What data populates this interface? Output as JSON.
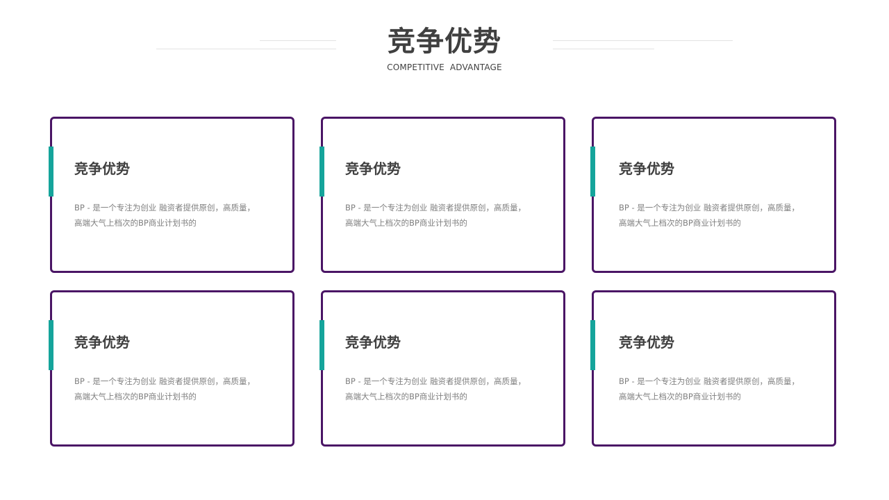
{
  "header": {
    "title": "竞争优势",
    "subtitle": "COMPETITIVE  ADVANTAGE"
  },
  "colors": {
    "title_text": "#404040",
    "body_text": "#7f7f7f",
    "card_border": "#4a1565",
    "card_accent": "#15a49b",
    "decor_line": "#e3e3e3"
  },
  "cards": [
    {
      "title": "竞争优势",
      "line1": "BP - 是一个专注为创业 融资者提供原创，高质量，",
      "line2": "高端大气上档次的BP商业计划书的"
    },
    {
      "title": "竞争优势",
      "line1": "BP - 是一个专注为创业 融资者提供原创，高质量，",
      "line2": "高端大气上档次的BP商业计划书的"
    },
    {
      "title": "竞争优势",
      "line1": "BP - 是一个专注为创业 融资者提供原创，高质量，",
      "line2": "高端大气上档次的BP商业计划书的"
    },
    {
      "title": "竞争优势",
      "line1": "BP - 是一个专注为创业 融资者提供原创，高质量，",
      "line2": "高端大气上档次的BP商业计划书的"
    },
    {
      "title": "竞争优势",
      "line1": "BP - 是一个专注为创业 融资者提供原创，高质量，",
      "line2": "高端大气上档次的BP商业计划书的"
    },
    {
      "title": "竞争优势",
      "line1": "BP - 是一个专注为创业 融资者提供原创，高质量，",
      "line2": "高端大气上档次的BP商业计划书的"
    }
  ]
}
